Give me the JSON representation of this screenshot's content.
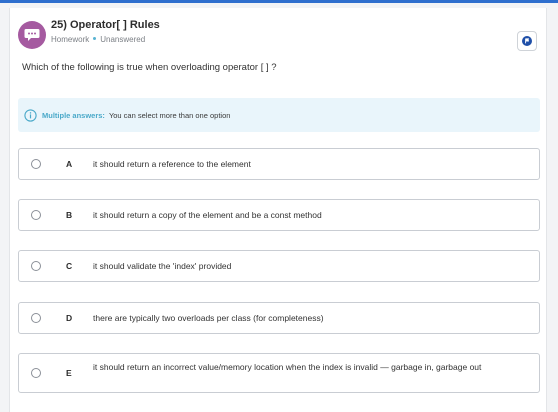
{
  "header": {
    "title": "25) Operator[ ] Rules",
    "type_label": "Homework",
    "status_label": "Unanswered",
    "colors": {
      "avatar": "#a55aa0",
      "status_dot": "#58b3d2",
      "flag": "#1f4fa8"
    }
  },
  "question": {
    "text": "Which of the following is true when overloading operator [ ] ?"
  },
  "info": {
    "strong": "Multiple answers:",
    "text": "You can select more than one option",
    "color": "#4aa9c9"
  },
  "options": [
    {
      "letter": "A",
      "text": "it should return a reference to the element"
    },
    {
      "letter": "B",
      "text": "it should return a copy of the element and be a const method"
    },
    {
      "letter": "C",
      "text": "it should validate the 'index' provided"
    },
    {
      "letter": "D",
      "text": "there are typically two overloads per class (for completeness)"
    },
    {
      "letter": "E",
      "text": "it should return an incorrect value/memory location when the index is invalid — garbage in, garbage out"
    }
  ]
}
